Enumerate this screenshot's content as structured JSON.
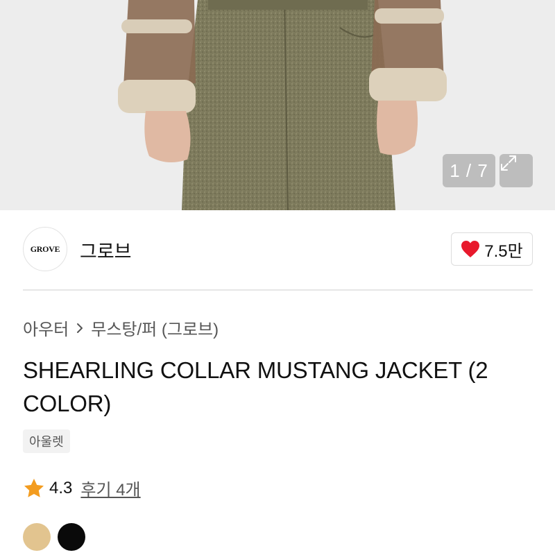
{
  "gallery": {
    "current": "1",
    "total": "7",
    "counter_text": "1 / 7",
    "expand_icon": "expand-arrows-icon"
  },
  "brand": {
    "logo_text": "GROVE",
    "name": "그로브",
    "like_icon": "heart-icon",
    "like_count": "7.5만",
    "like_color": "#e8192c"
  },
  "breadcrumb": {
    "items": [
      "아우터",
      "무스탕/퍼 (그로브)"
    ],
    "separator_icon": "chevron-right-icon"
  },
  "product": {
    "title": "SHEARLING COLLAR MUSTANG JACKET (2 COLOR)",
    "badge": "아울렛"
  },
  "rating": {
    "star_icon": "star-icon",
    "star_color": "#f39c1f",
    "value": "4.3",
    "reviews_label": "후기 4개"
  },
  "colors": [
    {
      "name": "beige",
      "hex": "#e2c48f"
    },
    {
      "name": "black",
      "hex": "#0a0a0a"
    }
  ]
}
